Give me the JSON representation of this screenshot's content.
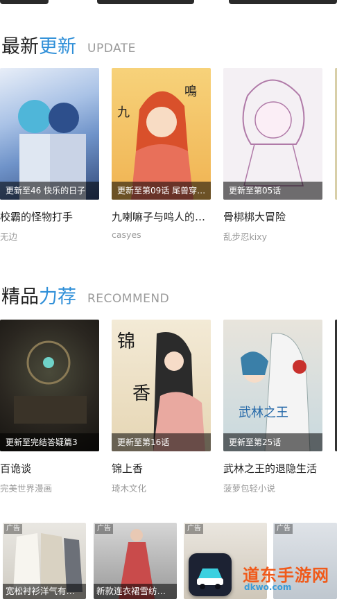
{
  "latest": {
    "title_black": "最新",
    "title_blue": "更新",
    "subtitle": "UPDATE",
    "items": [
      {
        "badge": "更新至46 快乐的日子",
        "title": "校霸的怪物打手",
        "author": "无边"
      },
      {
        "badge": "更新至第09话 尾兽穿…",
        "title": "九喇嘛子与鸣人的…",
        "author": "casyes"
      },
      {
        "badge": "更新至第05话",
        "title": "骨梆梆大冒险",
        "author": "乱步忍kixy"
      }
    ]
  },
  "recommend": {
    "title_black": "精品",
    "title_blue": "力荐",
    "subtitle": "RECOMMEND",
    "items": [
      {
        "badge": "更新至完结答疑篇3",
        "title": "百诡谈",
        "author": "完美世界漫画"
      },
      {
        "badge": "更新至第16话",
        "title": "锦上香",
        "author": "琦木文化"
      },
      {
        "badge": "更新至第25话",
        "title": "武林之王的退隐生活",
        "author": "菠萝包轻小说"
      }
    ]
  },
  "ads": [
    {
      "tag": "广告",
      "caption": "宽松衬衫洋气有…"
    },
    {
      "tag": "广告",
      "caption": "新款连衣裙雪纺…"
    },
    {
      "tag": "广告",
      "caption": ""
    },
    {
      "tag": "广告",
      "caption": ""
    }
  ],
  "watermark": {
    "text": "道东手游网",
    "sub": "dkwo.com"
  },
  "colors": {
    "accent": "#2f8fd8"
  }
}
